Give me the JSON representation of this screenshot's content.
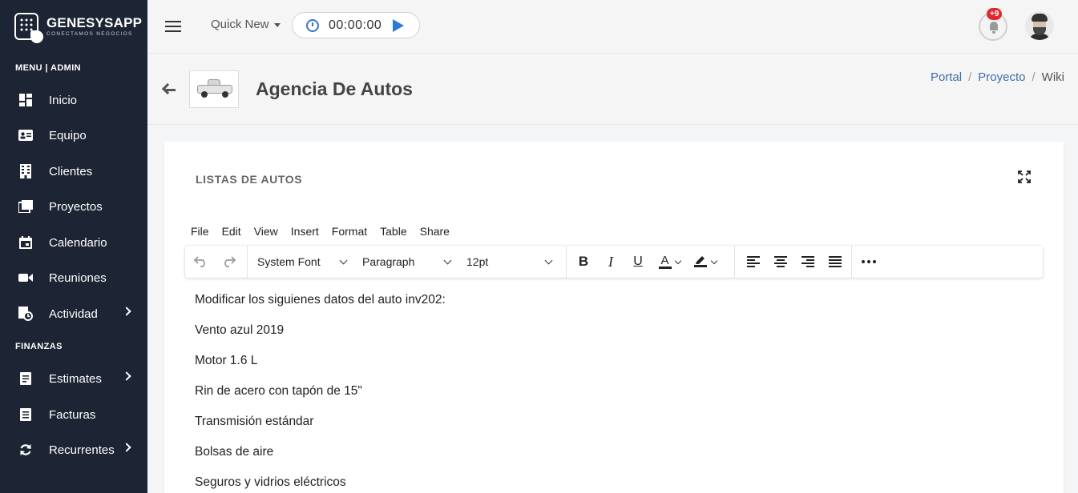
{
  "brand": {
    "name": "GENESYSAPP",
    "tagline": "CONECTAMOS NEGOCIOS"
  },
  "sidebar": {
    "menu_label": "MENU | ADMIN",
    "menu_items": [
      {
        "label": "Inicio",
        "icon": "dashboard-icon",
        "has_submenu": false
      },
      {
        "label": "Equipo",
        "icon": "id-card-icon",
        "has_submenu": false
      },
      {
        "label": "Clientes",
        "icon": "building-icon",
        "has_submenu": false
      },
      {
        "label": "Proyectos",
        "icon": "folders-icon",
        "has_submenu": false
      },
      {
        "label": "Calendario",
        "icon": "calendar-icon",
        "has_submenu": false
      },
      {
        "label": "Reuniones",
        "icon": "video-icon",
        "has_submenu": false
      },
      {
        "label": "Actividad",
        "icon": "activity-icon",
        "has_submenu": true
      }
    ],
    "finance_label": "FINANZAS",
    "finance_items": [
      {
        "label": "Estimates",
        "icon": "estimate-icon",
        "has_submenu": true
      },
      {
        "label": "Facturas",
        "icon": "invoice-icon",
        "has_submenu": false
      },
      {
        "label": "Recurrentes",
        "icon": "recurring-icon",
        "has_submenu": true
      }
    ]
  },
  "topbar": {
    "quick_new": "Quick New",
    "timer": "00:00:00",
    "notification_badge": "+9"
  },
  "header": {
    "title": "Agencia De Autos",
    "breadcrumb": [
      "Portal",
      "Proyecto",
      "Wiki"
    ]
  },
  "card": {
    "title": "LISTAS DE AUTOS",
    "menu": [
      "File",
      "Edit",
      "View",
      "Insert",
      "Format",
      "Table",
      "Share"
    ],
    "toolbar": {
      "font": "System Font",
      "block": "Paragraph",
      "size": "12pt"
    },
    "content": [
      "Modificar los siguienes datos del auto inv202:",
      "Vento azul 2019",
      "Motor 1.6 L",
      "Rin de acero con tapón de 15\"",
      "Transmisión estándar",
      "Bolsas de aire",
      "Seguros y vidrios eléctricos"
    ]
  },
  "colors": {
    "sidebar_bg": "#1d2433",
    "link": "#3d6fa8",
    "badge": "#e0282e",
    "play": "#2b7ad8"
  }
}
